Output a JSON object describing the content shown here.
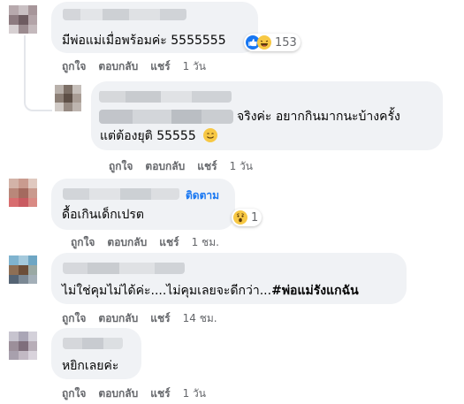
{
  "comments": [
    {
      "text": "มีพ่อแม่เมื่อพร้อมค่ะ 5555555",
      "reaction_count": "153",
      "actions": {
        "like": "ถูกใจ",
        "reply": "ตอบกลับ",
        "share": "แชร์",
        "time": "1 วัน"
      }
    },
    {
      "text_line1": "จริงค่ะ อยากกินมากนะบ้างครั้ง",
      "text_line2": "แต่ต้องยุติ 55555",
      "actions": {
        "like": "ถูกใจ",
        "reply": "ตอบกลับ",
        "share": "แชร์",
        "time": "1 วัน"
      }
    },
    {
      "follow_label": "ติดตาม",
      "text": "ดื้อเกินเด็กเปรต",
      "reaction_count": "1",
      "actions": {
        "like": "ถูกใจ",
        "reply": "ตอบกลับ",
        "share": "แชร์",
        "time": "1 ชม."
      }
    },
    {
      "text": "ไม่ใช่คุมไม่ได้ค่ะ....ไม่คุมเลยจะดีกว่า...",
      "hashtag": "#พ่อแม่รังแกฉัน",
      "actions": {
        "like": "ถูกใจ",
        "reply": "ตอบกลับ",
        "share": "แชร์",
        "time": "14 ชม."
      }
    },
    {
      "text": "หยิกเลยค่ะ",
      "actions": {
        "like": "ถูกใจ",
        "reply": "ตอบกลับ",
        "share": "แชร์",
        "time": "1 วัน"
      }
    }
  ],
  "colors": {
    "bubble": "#f0f2f5",
    "meta": "#65676b",
    "link": "#1877f2"
  },
  "icons": [
    "like-icon",
    "haha-icon",
    "wow-icon",
    "smile-emoji-icon"
  ]
}
